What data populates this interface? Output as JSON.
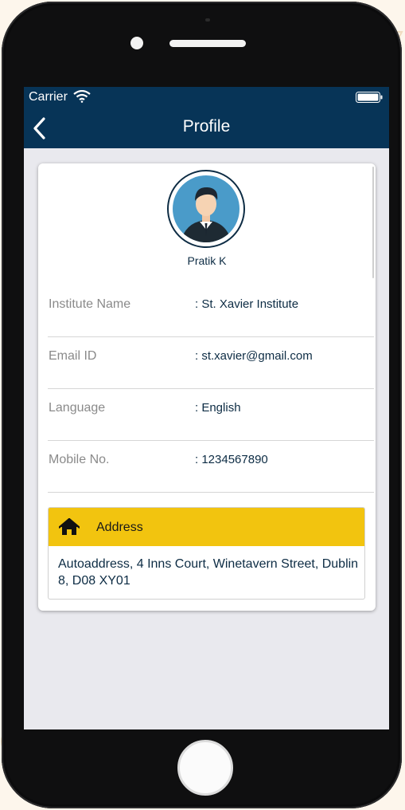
{
  "status_bar": {
    "carrier": "Carrier",
    "wifi_icon": "wifi-icon",
    "battery_icon": "battery-icon"
  },
  "navbar": {
    "back_icon": "chevron-left-icon",
    "title": "Profile",
    "background_color": "#073457"
  },
  "profile": {
    "avatar_icon": "user-avatar-icon",
    "name": "Pratik K",
    "fields": [
      {
        "label": "Institute Name",
        "value": ": St. Xavier Institute"
      },
      {
        "label": "Email ID",
        "value": ": st.xavier@gmail.com"
      },
      {
        "label": "Language",
        "value": ": English"
      },
      {
        "label": "Mobile No.",
        "value": ": 1234567890"
      }
    ]
  },
  "address": {
    "icon": "home-icon",
    "title": "Address",
    "text": "Autoaddress, 4 Inns Court, Winetavern Street, Dublin 8, D08 XY01",
    "header_color": "#f2c40f"
  }
}
